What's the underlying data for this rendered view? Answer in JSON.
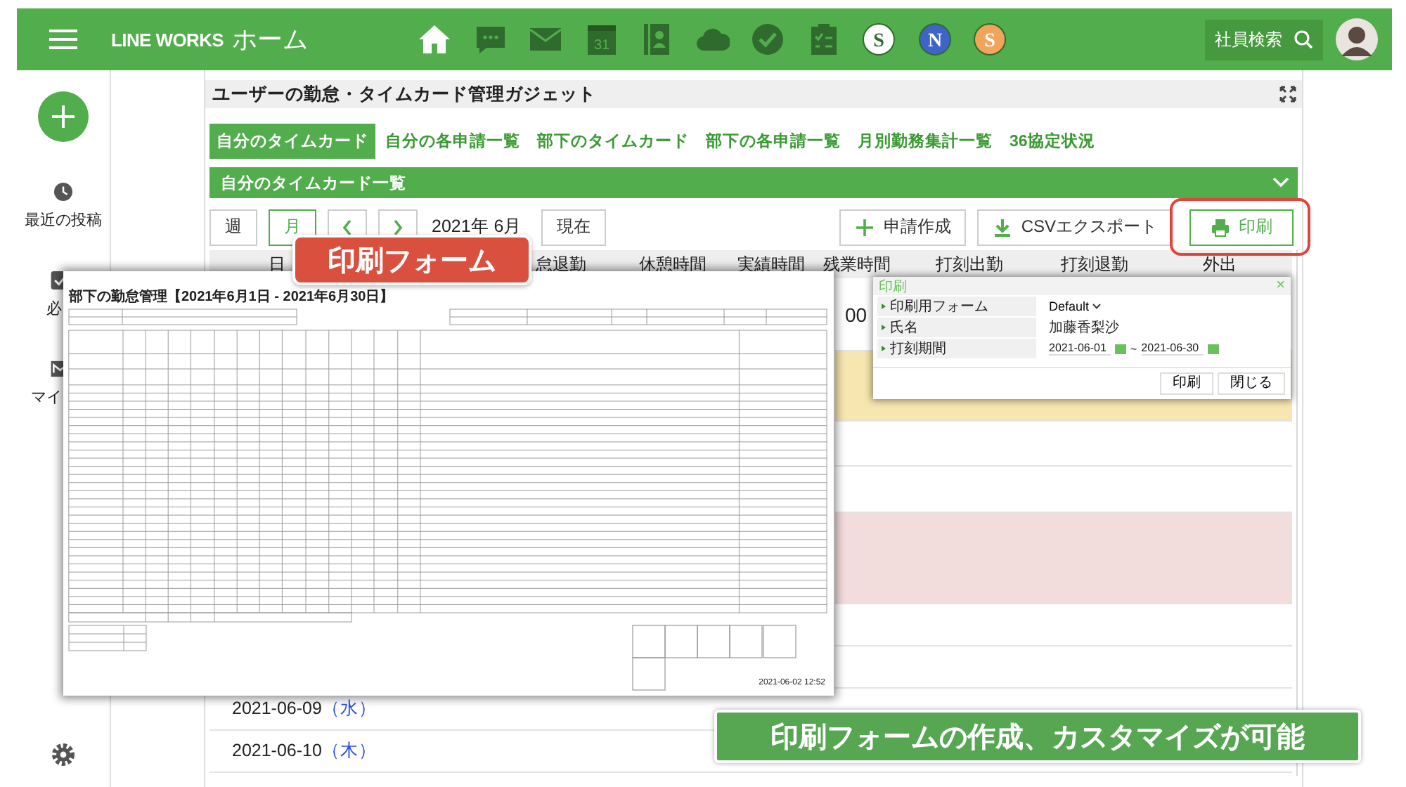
{
  "header": {
    "brand": "LINE WORKS",
    "page": "ホーム",
    "search": "社員検索",
    "apps": [
      {
        "kind": "home",
        "selected": true
      },
      {
        "kind": "chat",
        "selected": false
      },
      {
        "kind": "mail",
        "selected": false
      },
      {
        "kind": "calendar",
        "label": "31",
        "selected": false
      },
      {
        "kind": "contacts",
        "selected": false
      },
      {
        "kind": "cloud",
        "selected": false
      },
      {
        "kind": "check",
        "selected": false
      },
      {
        "kind": "tasks",
        "selected": false
      },
      {
        "kind": "badge",
        "label": "S",
        "color": "#ffffff",
        "selected": false
      },
      {
        "kind": "badge",
        "label": "N",
        "color": "#3f63c8",
        "selected": false
      },
      {
        "kind": "badge",
        "label": "S",
        "color": "#f0a55a",
        "selected": false
      }
    ]
  },
  "sidebar": {
    "items": [
      {
        "kind": "clock",
        "label": "最近の投稿"
      },
      {
        "kind": "check",
        "label": "必"
      },
      {
        "kind": "mail",
        "label": "マイ"
      }
    ]
  },
  "panel": {
    "title": "ユーザーの勤怠・タイムカード管理ガジェット",
    "tabs": [
      {
        "label": "自分のタイムカード",
        "selected": true
      },
      {
        "label": "自分の各申請一覧",
        "selected": false
      },
      {
        "label": "部下のタイムカード",
        "selected": false
      },
      {
        "label": "部下の各申請一覧",
        "selected": false
      },
      {
        "label": "月別勤務集計一覧",
        "selected": false
      },
      {
        "label": "36協定状況",
        "selected": false
      }
    ],
    "section": "自分のタイムカード一覧",
    "views": [
      {
        "label": "週",
        "selected": false
      },
      {
        "label": "月",
        "selected": true
      }
    ],
    "period": "2021年 6月",
    "today": "現在",
    "actions": [
      {
        "kind": "add",
        "label": "申請作成",
        "highlighted": false
      },
      {
        "kind": "download",
        "label": "CSVエクスポート",
        "highlighted": false
      },
      {
        "kind": "print",
        "label": "印刷",
        "highlighted": true
      }
    ],
    "table": {
      "columns": [
        "日",
        "怠退勤",
        "休憩時間",
        "実績時間",
        "残業時間",
        "打刻出勤",
        "打刻退勤",
        "外出"
      ],
      "rows": [
        {
          "color": "#ffffff",
          "value": "00"
        },
        {
          "color": "#f7e6b0"
        },
        {
          "color": "#ffffff"
        },
        {
          "color": "#ffffff"
        },
        {
          "color": "#f3dcdc"
        },
        {
          "color": "#ffffff"
        },
        {
          "color": "#ffffff"
        },
        {
          "color": "#ffffff",
          "date": "2021-06-09",
          "weekday": "（水）"
        },
        {
          "color": "#ffffff",
          "date": "2021-06-10",
          "weekday": "（木）"
        }
      ]
    }
  },
  "print_form": {
    "callout": "印刷フォーム",
    "title": "部下の勤怠管理【2021年6月1日 - 2021年6月30日】",
    "timestamp": "2021-06-02 12:52"
  },
  "dialog": {
    "title": "印刷",
    "close": "×",
    "fields": [
      {
        "kind": "select",
        "label": "印刷用フォーム",
        "value": "Default"
      },
      {
        "kind": "text",
        "label": "氏名",
        "value": "加藤香梨沙"
      },
      {
        "kind": "range",
        "label": "打刻期間",
        "from": "2021-06-01",
        "separator": "~",
        "to": "2021-06-30"
      }
    ],
    "buttons": [
      "印刷",
      "閉じる"
    ]
  },
  "caption": "印刷フォームの作成、カスタマイズが可能"
}
